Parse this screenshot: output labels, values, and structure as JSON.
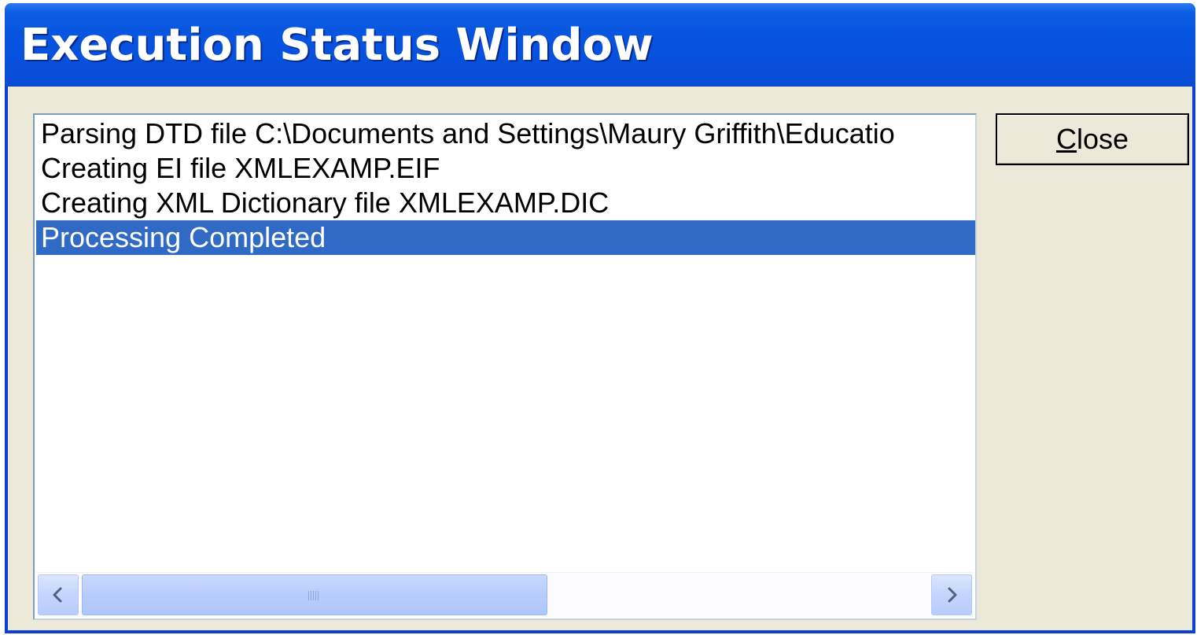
{
  "window": {
    "title": "Execution Status Window"
  },
  "listbox": {
    "items": [
      {
        "text": "Parsing DTD file C:\\Documents and Settings\\Maury Griffith\\Educatio",
        "selected": false
      },
      {
        "text": "Creating EI file XMLEXAMP.EIF",
        "selected": false
      },
      {
        "text": "Creating XML Dictionary file XMLEXAMP.DIC",
        "selected": false
      },
      {
        "text": "Processing Completed",
        "selected": true
      }
    ],
    "selection_color": "#316ac5"
  },
  "scrollbar": {
    "orientation": "horizontal",
    "left_icon": "chevron-left-icon",
    "right_icon": "chevron-right-icon",
    "grip_icon": "grip-icon"
  },
  "buttons": {
    "close_mnemonic": "C",
    "close_rest": "lose"
  },
  "colors": {
    "titlebar": "#0753df",
    "face": "#ece9d8"
  }
}
